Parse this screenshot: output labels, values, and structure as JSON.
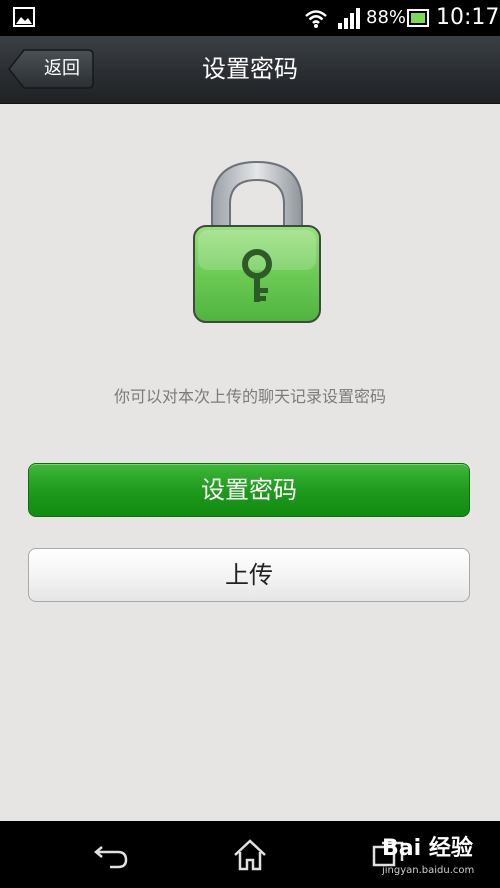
{
  "status_bar": {
    "battery_percent": "88%",
    "time": "10:17"
  },
  "title_bar": {
    "back_label": "返回",
    "title": "设置密码"
  },
  "main": {
    "hint": "你可以对本次上传的聊天记录设置密码",
    "set_password_button": "设置密码",
    "upload_button": "上传"
  },
  "watermark": {
    "main": "Bai 经验",
    "sub": "jingyan.baidu.com"
  },
  "icons": {
    "status": [
      "gallery-icon",
      "wifi-icon",
      "signal-icon",
      "battery-icon"
    ],
    "lock": "padlock-key-icon",
    "nav": [
      "back-icon",
      "home-icon",
      "recent-apps-icon"
    ]
  },
  "colors": {
    "accent_green": "#1f9b1d",
    "lock_green": "#6fcf5c",
    "background": "#e6e5e3"
  }
}
